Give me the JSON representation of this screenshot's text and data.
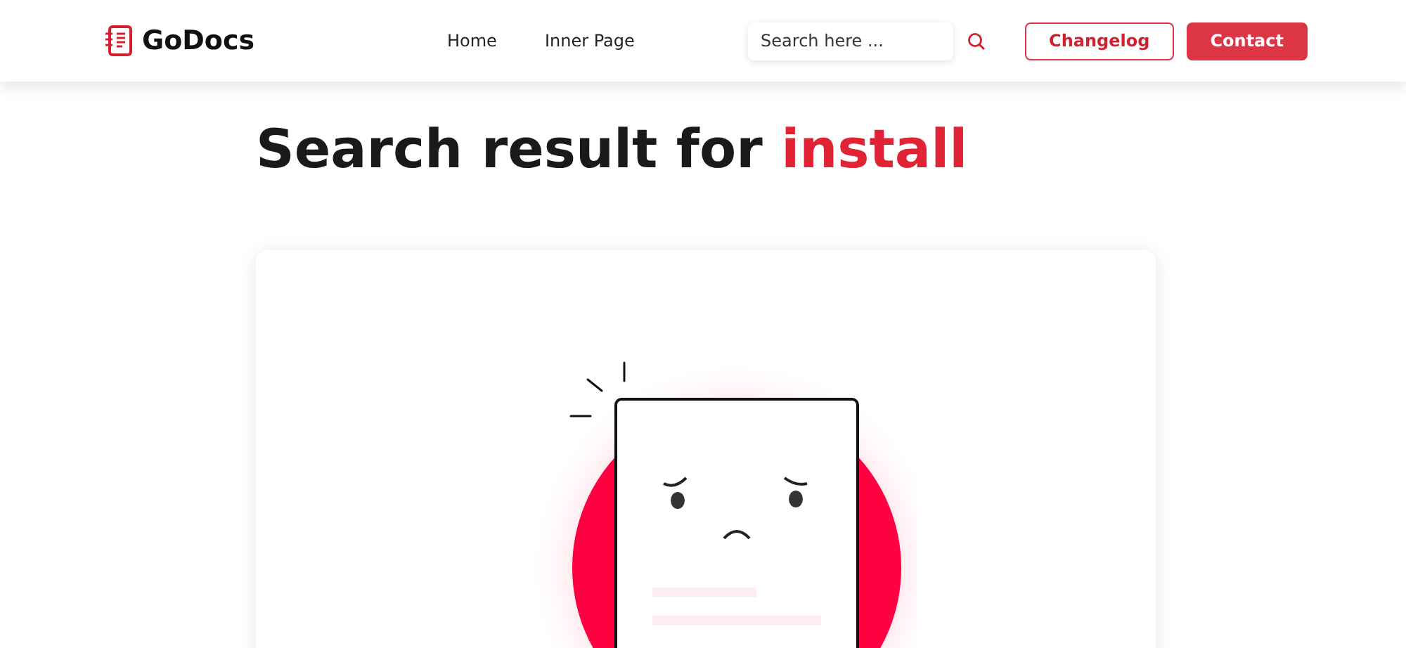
{
  "header": {
    "brand": "GoDocs",
    "nav": [
      {
        "label": "Home"
      },
      {
        "label": "Inner Page"
      }
    ],
    "search": {
      "placeholder": "Search here ..."
    },
    "buttons": [
      {
        "label": "Changelog",
        "kind": "outline"
      },
      {
        "label": "Contact",
        "kind": "solid"
      }
    ]
  },
  "results": {
    "title": "Search result for",
    "query": "install"
  }
}
